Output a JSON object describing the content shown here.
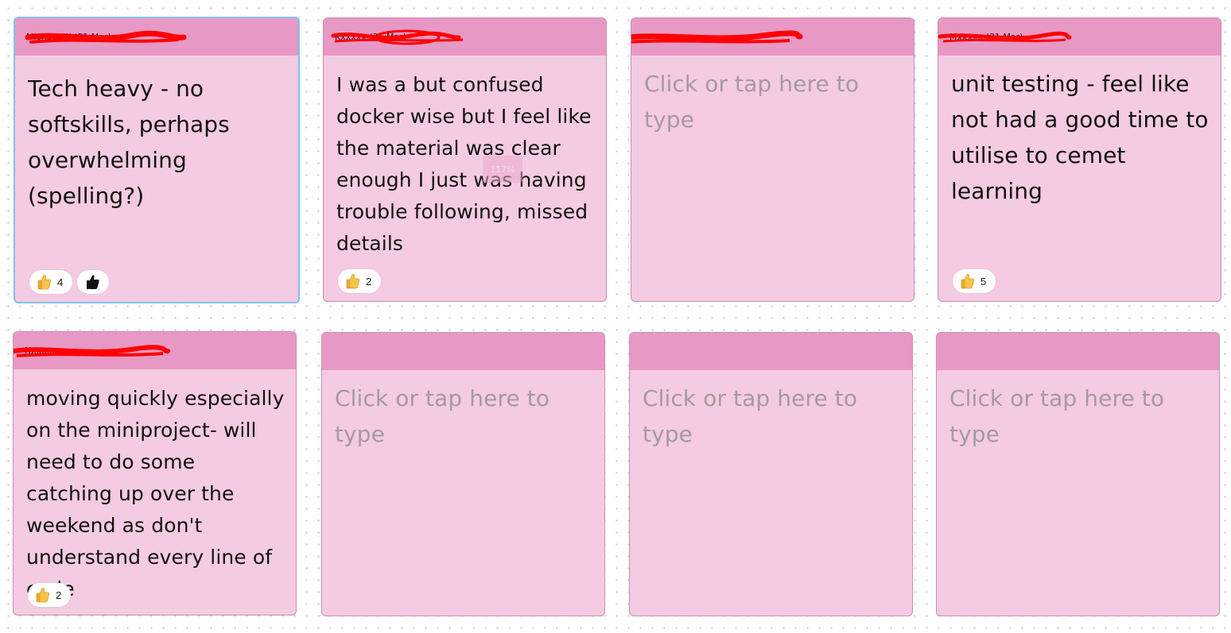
{
  "board": {
    "notes": [
      {
        "author": "Michael W (31 Mar)",
        "text": "Tech heavy -  no softskills, perhaps overwhelming (spelling?)",
        "placeholder": false,
        "selected": true,
        "reactions": [
          {
            "icon": "thumbs-up-emoji",
            "count": "4"
          },
          {
            "icon": "thumbs-up-add",
            "count": ""
          }
        ]
      },
      {
        "author": "Kxxxxx (31 Mar)",
        "text": "I was a but confused docker wise but I feel like the material was clear enough I just was having trouble following, missed details",
        "placeholder": false,
        "selected": false,
        "zoom_tooltip": "117%",
        "reactions": [
          {
            "icon": "thumbs-up-emoji",
            "count": "2"
          }
        ]
      },
      {
        "author": "",
        "text": "Click or tap here to type",
        "placeholder": true,
        "selected": false,
        "reactions": []
      },
      {
        "author": "Mxxxxx (31 Mar)",
        "text": "unit testing - feel like not had a good time to utilise to cemet learning",
        "placeholder": false,
        "selected": false,
        "reactions": [
          {
            "icon": "thumbs-up-emoji",
            "count": "5"
          }
        ]
      },
      {
        "author": "Nxxxxx",
        "text": "moving quickly especially on the miniproject- will need to do some catching up over the weekend as don't understand every line of code",
        "placeholder": false,
        "selected": false,
        "reactions": [
          {
            "icon": "thumbs-up-emoji",
            "count": "2"
          }
        ]
      },
      {
        "author": "",
        "text": "Click or tap here to type",
        "placeholder": true,
        "selected": false,
        "reactions": []
      },
      {
        "author": "",
        "text": "Click or tap here to type",
        "placeholder": true,
        "selected": false,
        "reactions": []
      },
      {
        "author": "",
        "text": "Click or tap here to type",
        "placeholder": true,
        "selected": false,
        "reactions": []
      }
    ]
  },
  "colors": {
    "note_body": "#f4cbe2",
    "note_header": "#e898c5",
    "placeholder_text": "#a59aa1",
    "selection_border": "#7fc2ea",
    "redaction": "#ff0000"
  }
}
